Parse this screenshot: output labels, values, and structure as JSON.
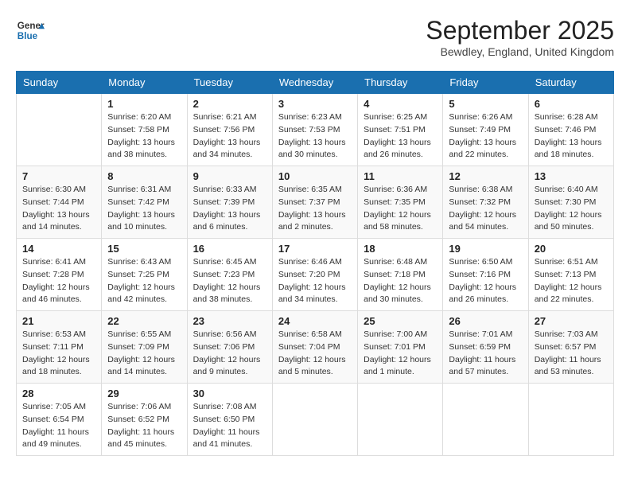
{
  "header": {
    "logo_line1": "General",
    "logo_line2": "Blue",
    "month_title": "September 2025",
    "location": "Bewdley, England, United Kingdom"
  },
  "weekdays": [
    "Sunday",
    "Monday",
    "Tuesday",
    "Wednesday",
    "Thursday",
    "Friday",
    "Saturday"
  ],
  "weeks": [
    [
      {
        "day": "",
        "sunrise": "",
        "sunset": "",
        "daylight": ""
      },
      {
        "day": "1",
        "sunrise": "Sunrise: 6:20 AM",
        "sunset": "Sunset: 7:58 PM",
        "daylight": "Daylight: 13 hours and 38 minutes."
      },
      {
        "day": "2",
        "sunrise": "Sunrise: 6:21 AM",
        "sunset": "Sunset: 7:56 PM",
        "daylight": "Daylight: 13 hours and 34 minutes."
      },
      {
        "day": "3",
        "sunrise": "Sunrise: 6:23 AM",
        "sunset": "Sunset: 7:53 PM",
        "daylight": "Daylight: 13 hours and 30 minutes."
      },
      {
        "day": "4",
        "sunrise": "Sunrise: 6:25 AM",
        "sunset": "Sunset: 7:51 PM",
        "daylight": "Daylight: 13 hours and 26 minutes."
      },
      {
        "day": "5",
        "sunrise": "Sunrise: 6:26 AM",
        "sunset": "Sunset: 7:49 PM",
        "daylight": "Daylight: 13 hours and 22 minutes."
      },
      {
        "day": "6",
        "sunrise": "Sunrise: 6:28 AM",
        "sunset": "Sunset: 7:46 PM",
        "daylight": "Daylight: 13 hours and 18 minutes."
      }
    ],
    [
      {
        "day": "7",
        "sunrise": "Sunrise: 6:30 AM",
        "sunset": "Sunset: 7:44 PM",
        "daylight": "Daylight: 13 hours and 14 minutes."
      },
      {
        "day": "8",
        "sunrise": "Sunrise: 6:31 AM",
        "sunset": "Sunset: 7:42 PM",
        "daylight": "Daylight: 13 hours and 10 minutes."
      },
      {
        "day": "9",
        "sunrise": "Sunrise: 6:33 AM",
        "sunset": "Sunset: 7:39 PM",
        "daylight": "Daylight: 13 hours and 6 minutes."
      },
      {
        "day": "10",
        "sunrise": "Sunrise: 6:35 AM",
        "sunset": "Sunset: 7:37 PM",
        "daylight": "Daylight: 13 hours and 2 minutes."
      },
      {
        "day": "11",
        "sunrise": "Sunrise: 6:36 AM",
        "sunset": "Sunset: 7:35 PM",
        "daylight": "Daylight: 12 hours and 58 minutes."
      },
      {
        "day": "12",
        "sunrise": "Sunrise: 6:38 AM",
        "sunset": "Sunset: 7:32 PM",
        "daylight": "Daylight: 12 hours and 54 minutes."
      },
      {
        "day": "13",
        "sunrise": "Sunrise: 6:40 AM",
        "sunset": "Sunset: 7:30 PM",
        "daylight": "Daylight: 12 hours and 50 minutes."
      }
    ],
    [
      {
        "day": "14",
        "sunrise": "Sunrise: 6:41 AM",
        "sunset": "Sunset: 7:28 PM",
        "daylight": "Daylight: 12 hours and 46 minutes."
      },
      {
        "day": "15",
        "sunrise": "Sunrise: 6:43 AM",
        "sunset": "Sunset: 7:25 PM",
        "daylight": "Daylight: 12 hours and 42 minutes."
      },
      {
        "day": "16",
        "sunrise": "Sunrise: 6:45 AM",
        "sunset": "Sunset: 7:23 PM",
        "daylight": "Daylight: 12 hours and 38 minutes."
      },
      {
        "day": "17",
        "sunrise": "Sunrise: 6:46 AM",
        "sunset": "Sunset: 7:20 PM",
        "daylight": "Daylight: 12 hours and 34 minutes."
      },
      {
        "day": "18",
        "sunrise": "Sunrise: 6:48 AM",
        "sunset": "Sunset: 7:18 PM",
        "daylight": "Daylight: 12 hours and 30 minutes."
      },
      {
        "day": "19",
        "sunrise": "Sunrise: 6:50 AM",
        "sunset": "Sunset: 7:16 PM",
        "daylight": "Daylight: 12 hours and 26 minutes."
      },
      {
        "day": "20",
        "sunrise": "Sunrise: 6:51 AM",
        "sunset": "Sunset: 7:13 PM",
        "daylight": "Daylight: 12 hours and 22 minutes."
      }
    ],
    [
      {
        "day": "21",
        "sunrise": "Sunrise: 6:53 AM",
        "sunset": "Sunset: 7:11 PM",
        "daylight": "Daylight: 12 hours and 18 minutes."
      },
      {
        "day": "22",
        "sunrise": "Sunrise: 6:55 AM",
        "sunset": "Sunset: 7:09 PM",
        "daylight": "Daylight: 12 hours and 14 minutes."
      },
      {
        "day": "23",
        "sunrise": "Sunrise: 6:56 AM",
        "sunset": "Sunset: 7:06 PM",
        "daylight": "Daylight: 12 hours and 9 minutes."
      },
      {
        "day": "24",
        "sunrise": "Sunrise: 6:58 AM",
        "sunset": "Sunset: 7:04 PM",
        "daylight": "Daylight: 12 hours and 5 minutes."
      },
      {
        "day": "25",
        "sunrise": "Sunrise: 7:00 AM",
        "sunset": "Sunset: 7:01 PM",
        "daylight": "Daylight: 12 hours and 1 minute."
      },
      {
        "day": "26",
        "sunrise": "Sunrise: 7:01 AM",
        "sunset": "Sunset: 6:59 PM",
        "daylight": "Daylight: 11 hours and 57 minutes."
      },
      {
        "day": "27",
        "sunrise": "Sunrise: 7:03 AM",
        "sunset": "Sunset: 6:57 PM",
        "daylight": "Daylight: 11 hours and 53 minutes."
      }
    ],
    [
      {
        "day": "28",
        "sunrise": "Sunrise: 7:05 AM",
        "sunset": "Sunset: 6:54 PM",
        "daylight": "Daylight: 11 hours and 49 minutes."
      },
      {
        "day": "29",
        "sunrise": "Sunrise: 7:06 AM",
        "sunset": "Sunset: 6:52 PM",
        "daylight": "Daylight: 11 hours and 45 minutes."
      },
      {
        "day": "30",
        "sunrise": "Sunrise: 7:08 AM",
        "sunset": "Sunset: 6:50 PM",
        "daylight": "Daylight: 11 hours and 41 minutes."
      },
      {
        "day": "",
        "sunrise": "",
        "sunset": "",
        "daylight": ""
      },
      {
        "day": "",
        "sunrise": "",
        "sunset": "",
        "daylight": ""
      },
      {
        "day": "",
        "sunrise": "",
        "sunset": "",
        "daylight": ""
      },
      {
        "day": "",
        "sunrise": "",
        "sunset": "",
        "daylight": ""
      }
    ]
  ]
}
